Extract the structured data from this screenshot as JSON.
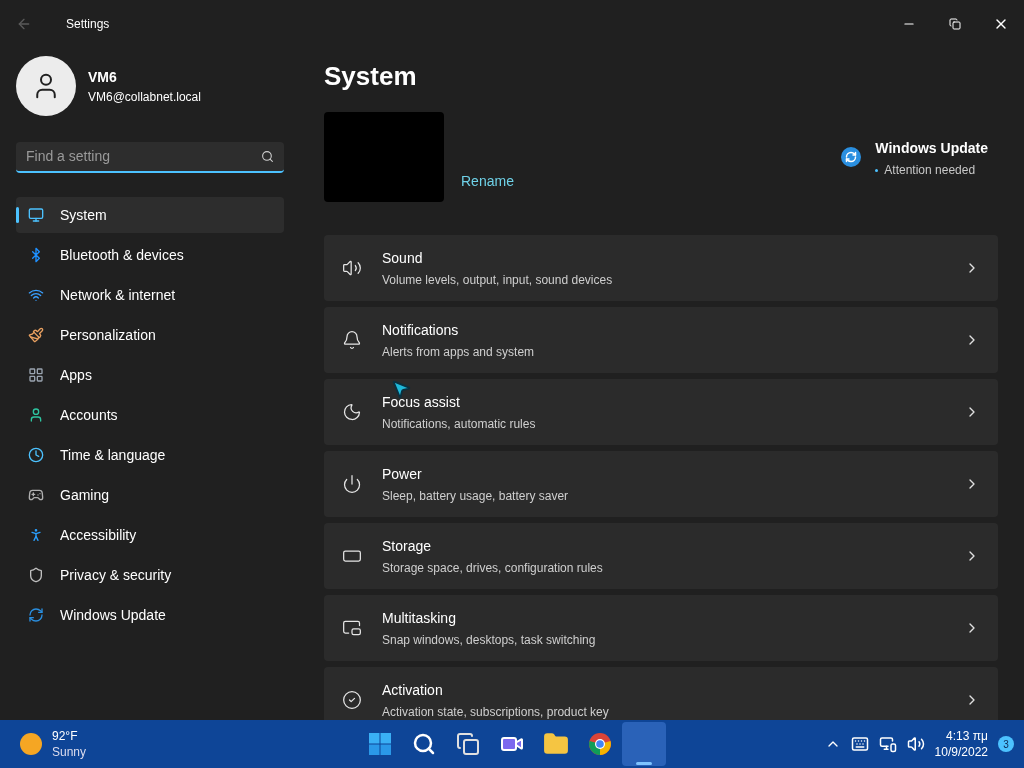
{
  "window": {
    "title": "Settings"
  },
  "user": {
    "name": "VM6",
    "email": "VM6@collabnet.local"
  },
  "search": {
    "placeholder": "Find a setting"
  },
  "nav": [
    {
      "kind": "system",
      "label": "System",
      "selected": true
    },
    {
      "kind": "bluetooth",
      "label": "Bluetooth & devices",
      "selected": false
    },
    {
      "kind": "network",
      "label": "Network & internet",
      "selected": false
    },
    {
      "kind": "personalization",
      "label": "Personalization",
      "selected": false
    },
    {
      "kind": "apps",
      "label": "Apps",
      "selected": false
    },
    {
      "kind": "accounts",
      "label": "Accounts",
      "selected": false
    },
    {
      "kind": "time",
      "label": "Time & language",
      "selected": false
    },
    {
      "kind": "gaming",
      "label": "Gaming",
      "selected": false
    },
    {
      "kind": "accessibility",
      "label": "Accessibility",
      "selected": false
    },
    {
      "kind": "privacy",
      "label": "Privacy & security",
      "selected": false
    },
    {
      "kind": "update",
      "label": "Windows Update",
      "selected": false
    }
  ],
  "page": {
    "title": "System",
    "rename": "Rename",
    "update": {
      "title": "Windows Update",
      "status": "Attention needed"
    }
  },
  "cards": [
    {
      "kind": "sound",
      "title": "Sound",
      "subtitle": "Volume levels, output, input, sound devices"
    },
    {
      "kind": "notifications",
      "title": "Notifications",
      "subtitle": "Alerts from apps and system"
    },
    {
      "kind": "focus",
      "title": "Focus assist",
      "subtitle": "Notifications, automatic rules"
    },
    {
      "kind": "power",
      "title": "Power",
      "subtitle": "Sleep, battery usage, battery saver"
    },
    {
      "kind": "storage",
      "title": "Storage",
      "subtitle": "Storage space, drives, configuration rules"
    },
    {
      "kind": "multitasking",
      "title": "Multitasking",
      "subtitle": "Snap windows, desktops, task switching"
    },
    {
      "kind": "activation",
      "title": "Activation",
      "subtitle": "Activation state, subscriptions, product key"
    }
  ],
  "taskbar": {
    "weather": {
      "temp": "92°F",
      "condition": "Sunny"
    },
    "apps": [
      {
        "kind": "start",
        "selected": false
      },
      {
        "kind": "search",
        "selected": false
      },
      {
        "kind": "taskview",
        "selected": false
      },
      {
        "kind": "chat",
        "selected": false
      },
      {
        "kind": "explorer",
        "selected": false
      },
      {
        "kind": "chrome",
        "selected": false
      },
      {
        "kind": "blank",
        "selected": true
      }
    ],
    "time": "4:13 πμ",
    "date": "10/9/2022",
    "badge": "3"
  }
}
